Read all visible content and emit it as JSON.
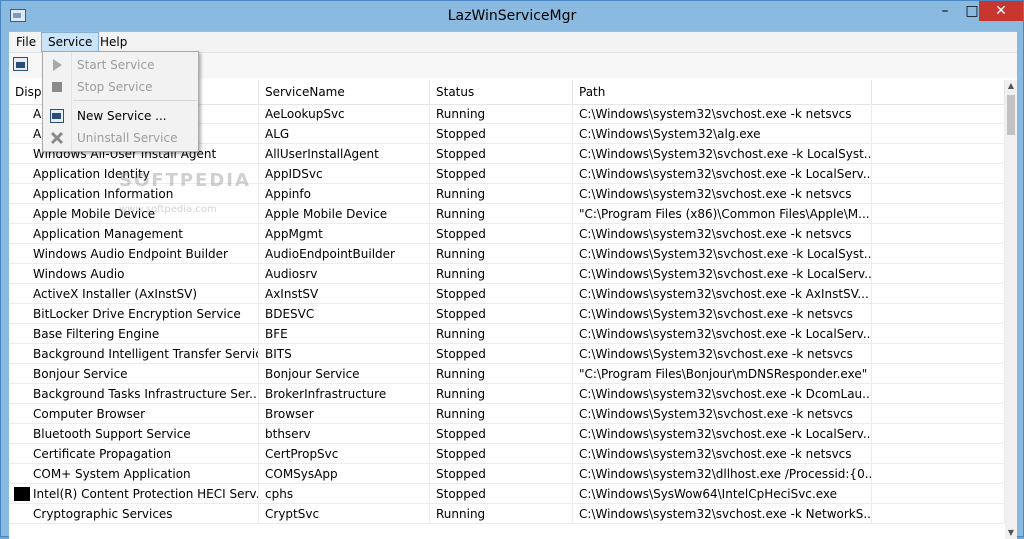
{
  "window": {
    "title": "LazWinServiceMgr"
  },
  "titlebar_buttons": {
    "minimize": "–",
    "maximize": "□",
    "close": "✕"
  },
  "menu": {
    "file": "File",
    "service": "Service",
    "help": "Help"
  },
  "service_menu": {
    "start": "Start Service",
    "stop": "Stop Service",
    "new": "New Service ...",
    "uninstall": "Uninstall Service"
  },
  "columns": [
    "Disp",
    "ServiceName",
    "Status",
    "Path",
    ""
  ],
  "watermark": {
    "main": "SOFTPEDIA",
    "sub": "www.softpedia.com"
  },
  "rows": [
    {
      "display": "A",
      "name": "AeLookupSvc",
      "status": "Running",
      "path": "C:\\Windows\\system32\\svchost.exe -k netsvcs",
      "icon": ""
    },
    {
      "display": "A          ervice",
      "name": "ALG",
      "status": "Stopped",
      "path": "C:\\Windows\\System32\\alg.exe",
      "icon": ""
    },
    {
      "display": "Windows All-User Install Agent",
      "name": "AllUserInstallAgent",
      "status": "Stopped",
      "path": "C:\\Windows\\System32\\svchost.exe -k LocalSyst...",
      "icon": ""
    },
    {
      "display": "Application Identity",
      "name": "AppIDSvc",
      "status": "Stopped",
      "path": "C:\\Windows\\system32\\svchost.exe -k LocalServ...",
      "icon": ""
    },
    {
      "display": "Application Information",
      "name": "Appinfo",
      "status": "Running",
      "path": "C:\\Windows\\system32\\svchost.exe -k netsvcs",
      "icon": ""
    },
    {
      "display": "Apple Mobile Device",
      "name": "Apple Mobile Device",
      "status": "Running",
      "path": "\"C:\\Program Files (x86)\\Common Files\\Apple\\M...",
      "icon": ""
    },
    {
      "display": "Application Management",
      "name": "AppMgmt",
      "status": "Stopped",
      "path": "C:\\Windows\\system32\\svchost.exe -k netsvcs",
      "icon": ""
    },
    {
      "display": "Windows Audio Endpoint Builder",
      "name": "AudioEndpointBuilder",
      "status": "Running",
      "path": "C:\\Windows\\System32\\svchost.exe -k LocalSyst...",
      "icon": ""
    },
    {
      "display": "Windows Audio",
      "name": "Audiosrv",
      "status": "Running",
      "path": "C:\\Windows\\System32\\svchost.exe -k LocalServ...",
      "icon": ""
    },
    {
      "display": "ActiveX Installer (AxInstSV)",
      "name": "AxInstSV",
      "status": "Stopped",
      "path": "C:\\Windows\\system32\\svchost.exe -k AxInstSV...",
      "icon": ""
    },
    {
      "display": "BitLocker Drive Encryption Service",
      "name": "BDESVC",
      "status": "Stopped",
      "path": "C:\\Windows\\System32\\svchost.exe -k netsvcs",
      "icon": ""
    },
    {
      "display": "Base Filtering Engine",
      "name": "BFE",
      "status": "Running",
      "path": "C:\\Windows\\system32\\svchost.exe -k LocalServ...",
      "icon": ""
    },
    {
      "display": "Background Intelligent Transfer Service",
      "name": "BITS",
      "status": "Stopped",
      "path": "C:\\Windows\\System32\\svchost.exe -k netsvcs",
      "icon": ""
    },
    {
      "display": "Bonjour Service",
      "name": "Bonjour Service",
      "status": "Running",
      "path": "\"C:\\Program Files\\Bonjour\\mDNSResponder.exe\"",
      "icon": ""
    },
    {
      "display": "Background Tasks Infrastructure Ser...",
      "name": "BrokerInfrastructure",
      "status": "Running",
      "path": "C:\\Windows\\system32\\svchost.exe -k DcomLau...",
      "icon": ""
    },
    {
      "display": "Computer Browser",
      "name": "Browser",
      "status": "Running",
      "path": "C:\\Windows\\System32\\svchost.exe -k netsvcs",
      "icon": ""
    },
    {
      "display": "Bluetooth Support Service",
      "name": "bthserv",
      "status": "Stopped",
      "path": "C:\\Windows\\system32\\svchost.exe -k LocalServ...",
      "icon": ""
    },
    {
      "display": "Certificate Propagation",
      "name": "CertPropSvc",
      "status": "Stopped",
      "path": "C:\\Windows\\system32\\svchost.exe -k netsvcs",
      "icon": ""
    },
    {
      "display": "COM+ System Application",
      "name": "COMSysApp",
      "status": "Stopped",
      "path": "C:\\Windows\\system32\\dllhost.exe /Processid:{0...",
      "icon": ""
    },
    {
      "display": "Intel(R) Content Protection HECI Serv...",
      "name": "cphs",
      "status": "Stopped",
      "path": "C:\\Windows\\SysWow64\\IntelCpHeciSvc.exe",
      "icon": "black-square-icon"
    },
    {
      "display": "Cryptographic Services",
      "name": "CryptSvc",
      "status": "Running",
      "path": "C:\\Windows\\system32\\svchost.exe -k NetworkS...",
      "icon": ""
    }
  ]
}
